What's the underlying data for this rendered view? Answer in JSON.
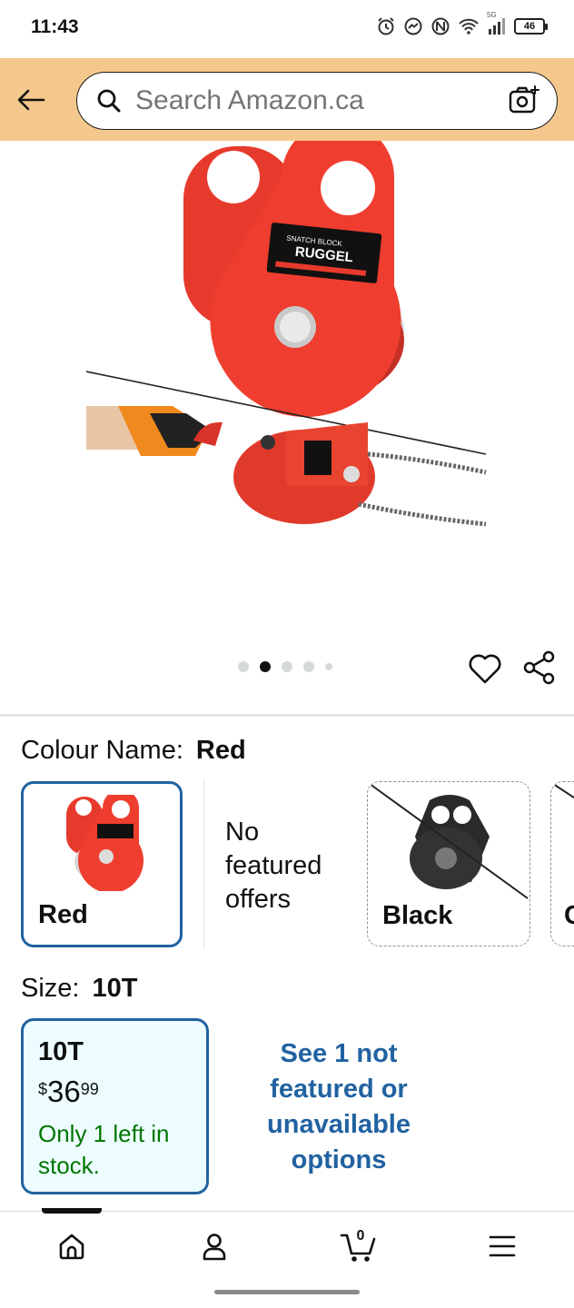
{
  "status_bar": {
    "time": "11:43",
    "network_label": "5G",
    "battery_level": "46"
  },
  "header": {
    "search_placeholder": "Search Amazon.ca",
    "background_color": "#f4c88c"
  },
  "gallery": {
    "image_count": 5,
    "active_index": 1,
    "product_color": "#e8352a"
  },
  "colour": {
    "label": "Colour Name:",
    "selected": "Red",
    "options": [
      {
        "name": "Red",
        "selected": true,
        "available": true
      },
      {
        "name": "No featured offers"
      },
      {
        "name": "Black",
        "selected": false,
        "available": false
      },
      {
        "name": "C",
        "selected": false,
        "available": false
      }
    ],
    "no_offers_text": "No featured offers"
  },
  "size": {
    "label": "Size:",
    "selected": "10T",
    "option": {
      "name": "10T",
      "currency": "$",
      "price_whole": "36",
      "price_fraction": "99",
      "stock": "Only 1 left in stock."
    },
    "see_more": "See 1 not featured or unavailable options"
  },
  "bottom_nav": {
    "items": [
      "home-icon",
      "account-icon",
      "cart-icon",
      "menu-icon"
    ],
    "cart_count": "0",
    "active": "home"
  },
  "colors": {
    "link_blue": "#2162a1",
    "stock_green": "#007600",
    "selected_bg": "#edfdff"
  }
}
